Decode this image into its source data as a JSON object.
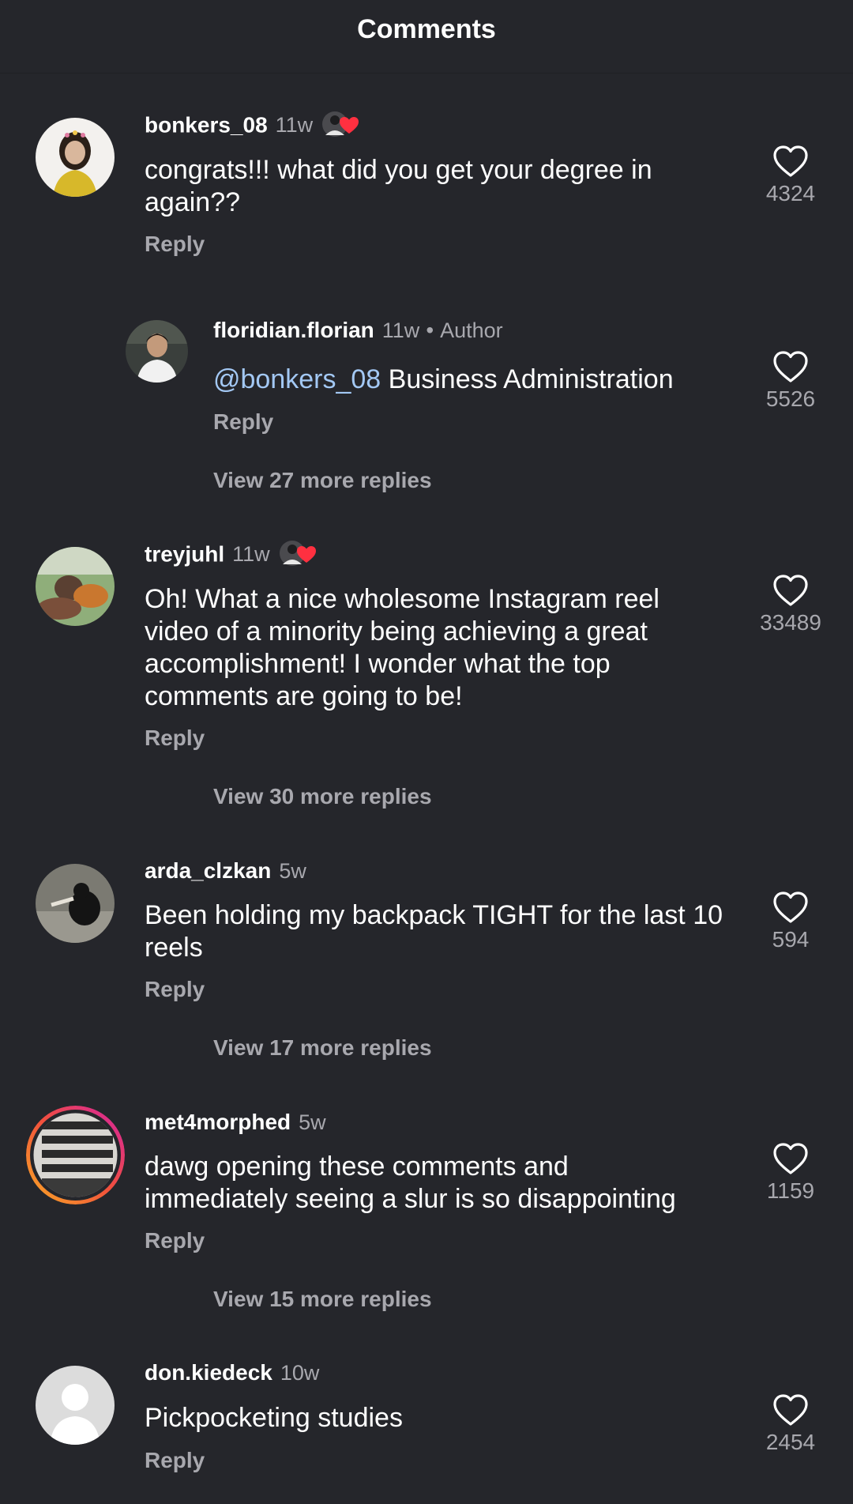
{
  "header": {
    "title": "Comments"
  },
  "comments": [
    {
      "username": "bonkers_08",
      "time": "11w",
      "text": "congrats!!! what did you get your degree in again??",
      "reply_label": "Reply",
      "likes": "4324",
      "liked_by_author": true
    },
    {
      "username": "floridian.florian",
      "time": "11w",
      "author_label": "Author",
      "mention": "@bonkers_08",
      "text": " Business Administration",
      "reply_label": "Reply",
      "likes": "5526",
      "view_replies": "View 27 more replies"
    },
    {
      "username": "treyjuhl",
      "time": "11w",
      "text": "Oh! What a nice wholesome Instagram reel video of a minority being achieving a great accomplishment! I wonder what the top comments are going to be!",
      "reply_label": "Reply",
      "likes": "33489",
      "liked_by_author": true,
      "view_replies": "View 30 more replies"
    },
    {
      "username": "arda_clzkan",
      "time": "5w",
      "text": "Been holding my backpack TIGHT for the last 10 reels",
      "reply_label": "Reply",
      "likes": "594",
      "view_replies": "View 17 more replies"
    },
    {
      "username": "met4morphed",
      "time": "5w",
      "text": "dawg opening these comments and immediately seeing a slur is so disappointing",
      "reply_label": "Reply",
      "likes": "1159",
      "view_replies": "View 15 more replies"
    },
    {
      "username": "don.kiedeck",
      "time": "10w",
      "text": "Pickpocketing studies",
      "reply_label": "Reply",
      "likes": "2454"
    }
  ],
  "icons": {
    "like": "heart-outline-icon",
    "liked_by_author": "author-liked-heart-icon"
  },
  "colors": {
    "background": "#25262b",
    "secondary_text": "#a8a8ae",
    "mention": "#a3c8f4",
    "heart_red": "#ff3040",
    "story_ring_start": "#f9a825",
    "story_ring_end": "#d6249f"
  }
}
